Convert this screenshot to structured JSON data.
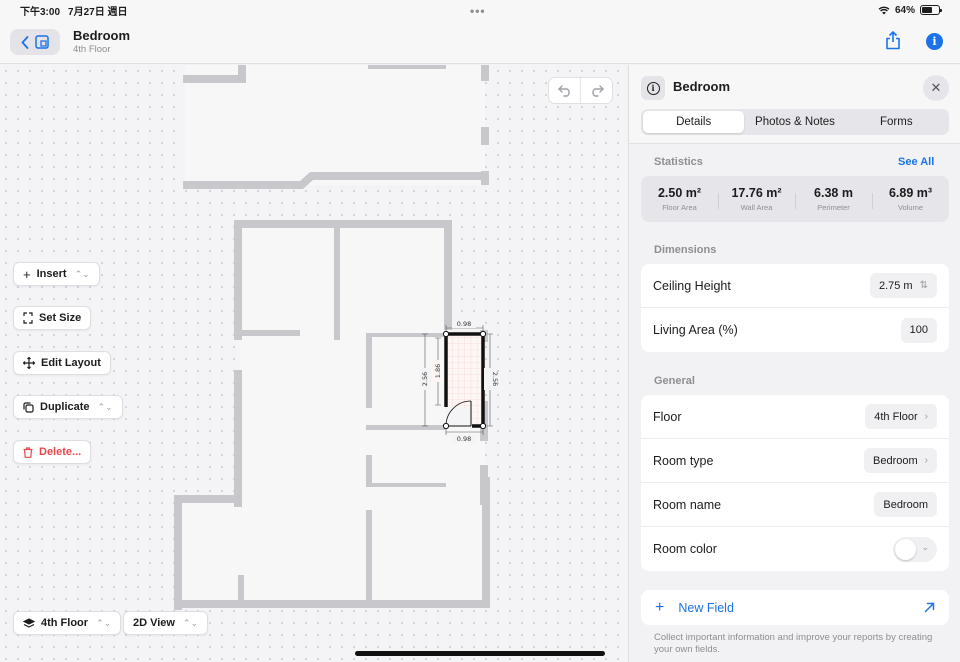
{
  "status_bar": {
    "time": "下午3:00",
    "date": "7月27日 週日",
    "battery_percent": "64%",
    "battery_level": 0.64
  },
  "nav": {
    "title": "Bedroom",
    "subtitle": "4th Floor"
  },
  "canvas": {
    "dimensions": {
      "top_width": "0.98",
      "bottom_width": "0.98",
      "left_height": "2.56",
      "inner_height": "1.86",
      "right_height": "2.56"
    },
    "tools": {
      "insert": "Insert",
      "set_size": "Set Size",
      "edit_layout": "Edit Layout",
      "duplicate": "Duplicate",
      "delete": "Delete..."
    },
    "floor_selector": "4th Floor",
    "view_selector": "2D View",
    "selected_room_color": "#111111",
    "wall_color": "#c8c8cc"
  },
  "panel": {
    "title": "Bedroom",
    "tabs": [
      {
        "label": "Details",
        "active": true
      },
      {
        "label": "Photos & Notes",
        "active": false
      },
      {
        "label": "Forms",
        "active": false
      }
    ],
    "statistics": {
      "label": "Statistics",
      "see_all": "See All",
      "items": [
        {
          "value": "2.50 m²",
          "label": "Floor Area"
        },
        {
          "value": "17.76 m²",
          "label": "Wall Area"
        },
        {
          "value": "6.38 m",
          "label": "Perimeter"
        },
        {
          "value": "6.89 m³",
          "label": "Volume"
        }
      ]
    },
    "dimensions": {
      "label": "Dimensions",
      "rows": [
        {
          "label": "Ceiling Height",
          "value": "2.75 m"
        },
        {
          "label": "Living Area (%)",
          "value": "100"
        }
      ]
    },
    "general": {
      "label": "General",
      "rows": [
        {
          "label": "Floor",
          "value": "4th Floor"
        },
        {
          "label": "Room type",
          "value": "Bedroom"
        },
        {
          "label": "Room name",
          "value": "Bedroom"
        },
        {
          "label": "Room color",
          "value": ""
        }
      ]
    },
    "new_field": "New Field",
    "footnote": "Collect important information and improve your reports by creating your own fields."
  },
  "accent_color": "#1a73e8",
  "danger_color": "#e5484d"
}
